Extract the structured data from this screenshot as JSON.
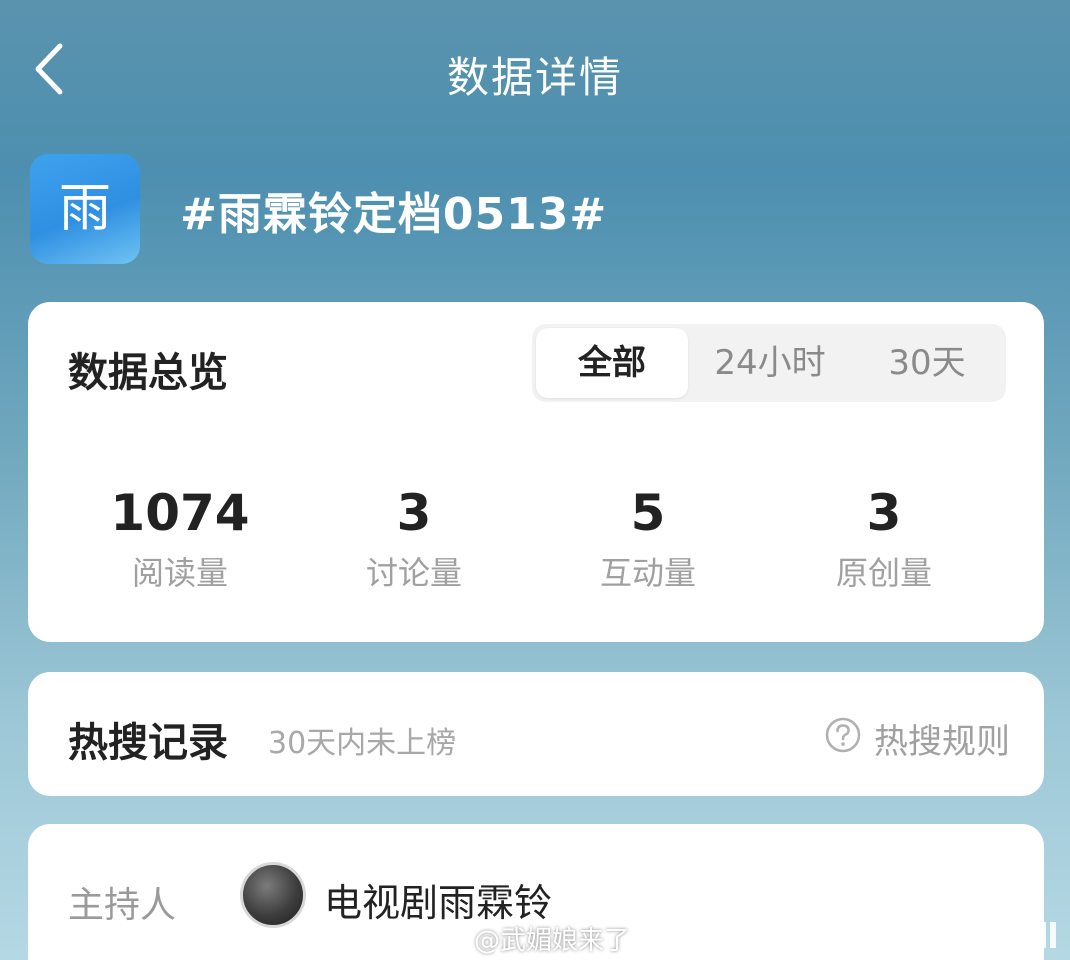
{
  "nav": {
    "title": "数据详情",
    "back_icon": "chevron-left-icon"
  },
  "topic": {
    "logo_char": "雨",
    "title": "#雨霖铃定档0513#"
  },
  "overview": {
    "title": "数据总览",
    "tabs": [
      {
        "label": "全部",
        "active": true
      },
      {
        "label": "24小时",
        "active": false
      },
      {
        "label": "30天",
        "active": false
      }
    ],
    "stats": [
      {
        "value": "1074",
        "label": "阅读量"
      },
      {
        "value": "3",
        "label": "讨论量"
      },
      {
        "value": "5",
        "label": "互动量"
      },
      {
        "value": "3",
        "label": "原创量"
      }
    ]
  },
  "hot_search": {
    "title": "热搜记录",
    "subtitle": "30天内未上榜",
    "rule_icon": "question-circle-icon",
    "rule_label": "热搜规则"
  },
  "host": {
    "label": "主持人",
    "name": "电视剧雨霖铃"
  },
  "watermark": {
    "icon": "weibo-icon",
    "text": "@武媚娘来了"
  },
  "colors": {
    "background_top": "#5a93ad",
    "background_bottom": "#b5d8e4",
    "logo_blue": "#3ea2ee",
    "text_dark": "#222222",
    "text_gray": "#a0a0a0"
  }
}
